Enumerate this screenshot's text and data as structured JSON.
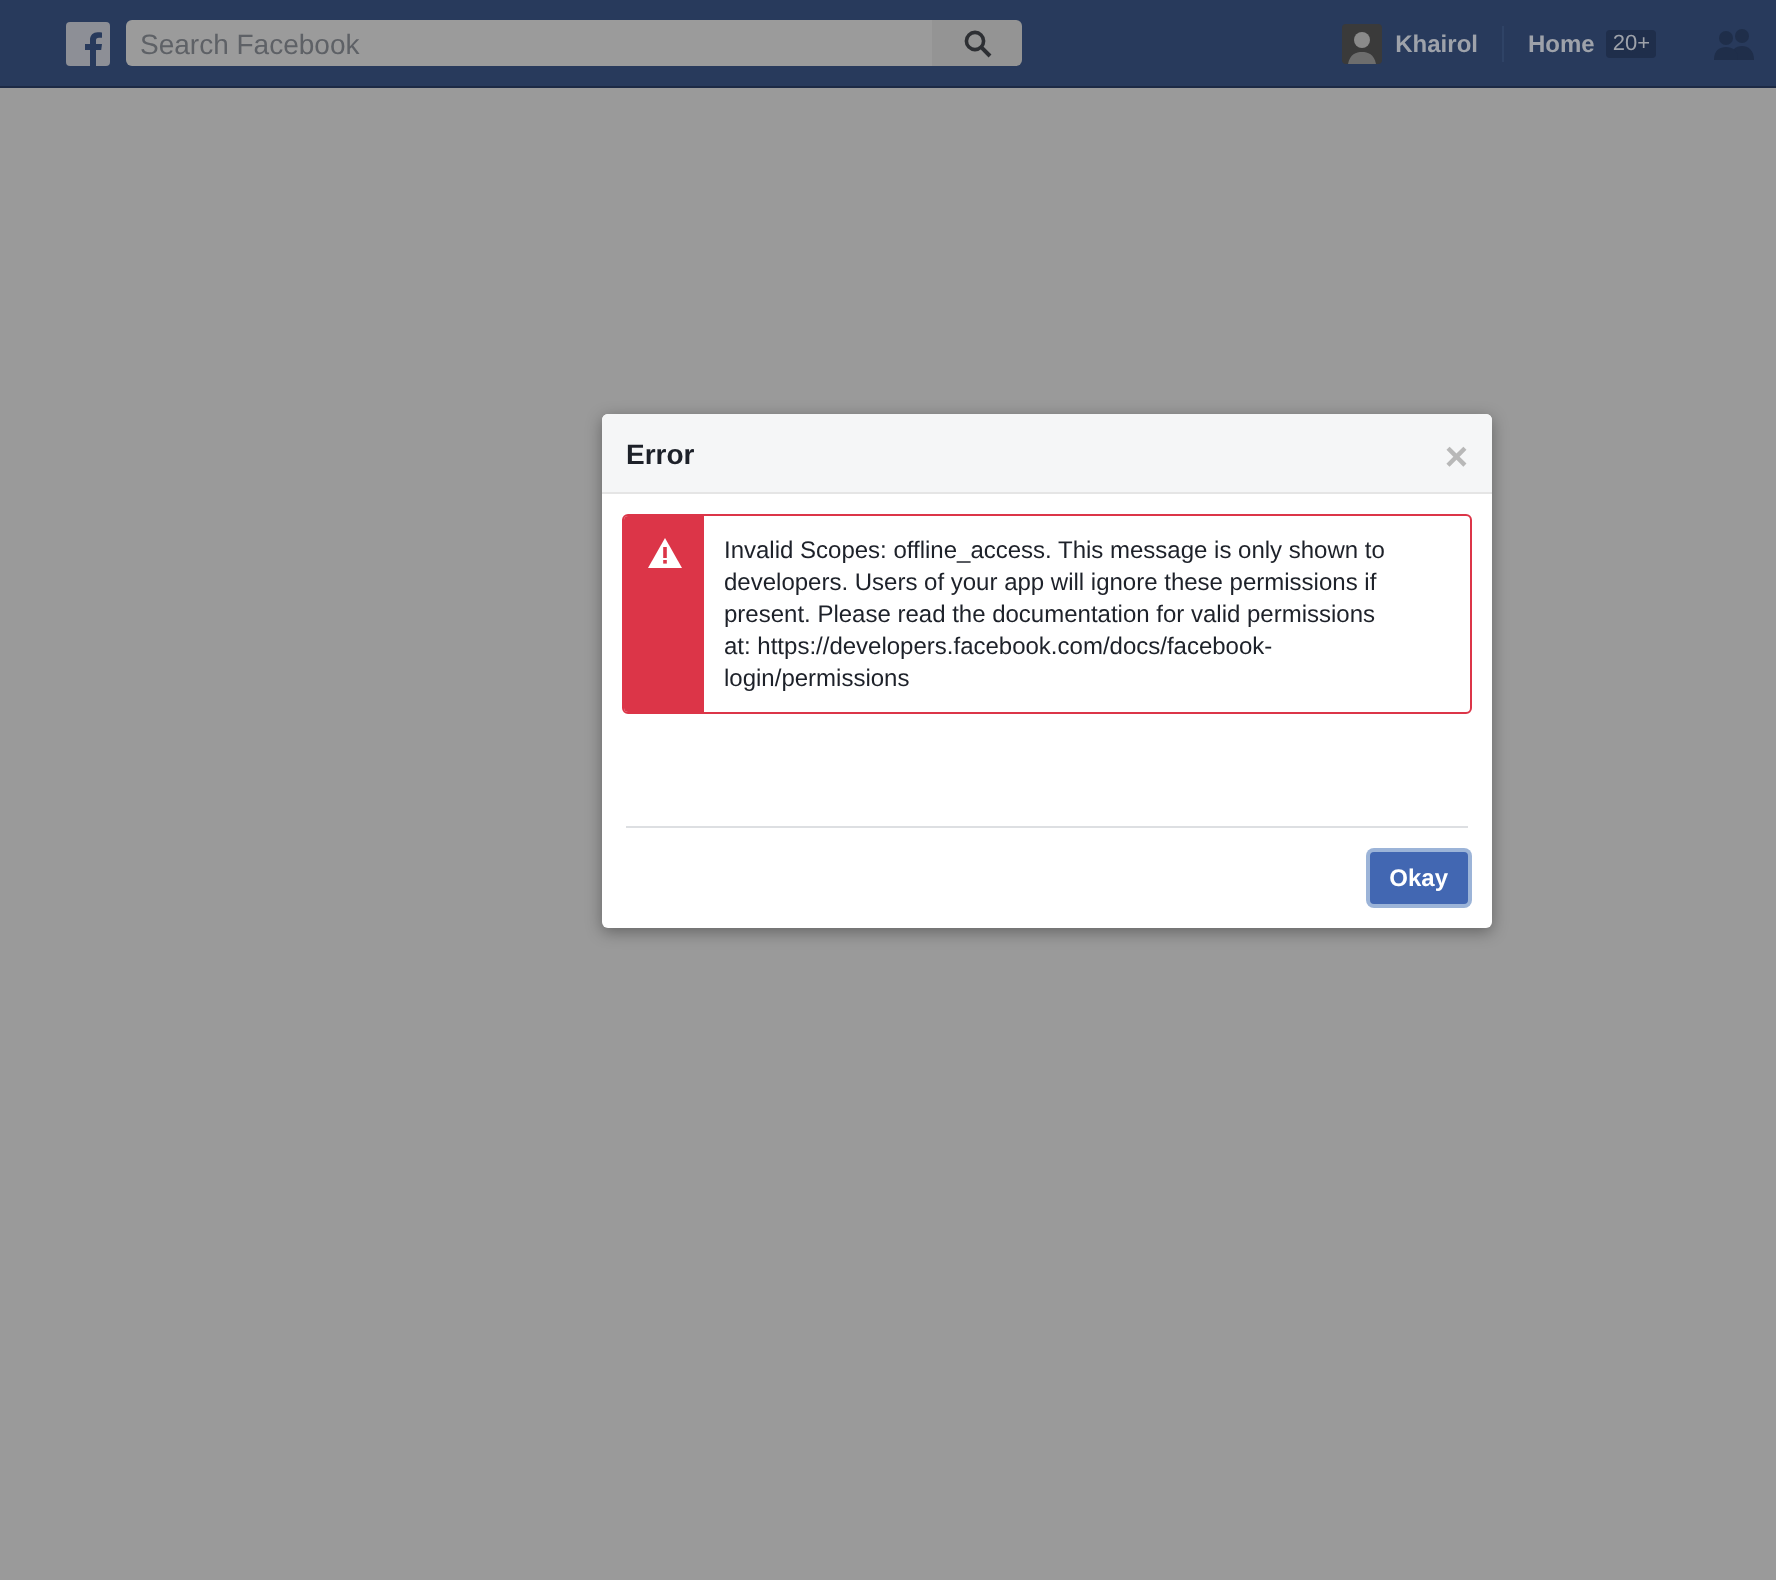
{
  "top_bar": {
    "search": {
      "placeholder": "Search Facebook"
    },
    "user": {
      "name": "Khairol"
    },
    "home": {
      "label": "Home",
      "badge": "20+"
    }
  },
  "dialog": {
    "title": "Error",
    "close": "×",
    "message": "Invalid Scopes: offline_access. This message is only shown to developers. Users of your app will ignore these permissions if present. Please read the documentation for valid permissions at: https://developers.facebook.com/docs/facebook-login/permissions",
    "buttons": [
      {
        "label": "Okay",
        "kind": "primary"
      }
    ]
  }
}
